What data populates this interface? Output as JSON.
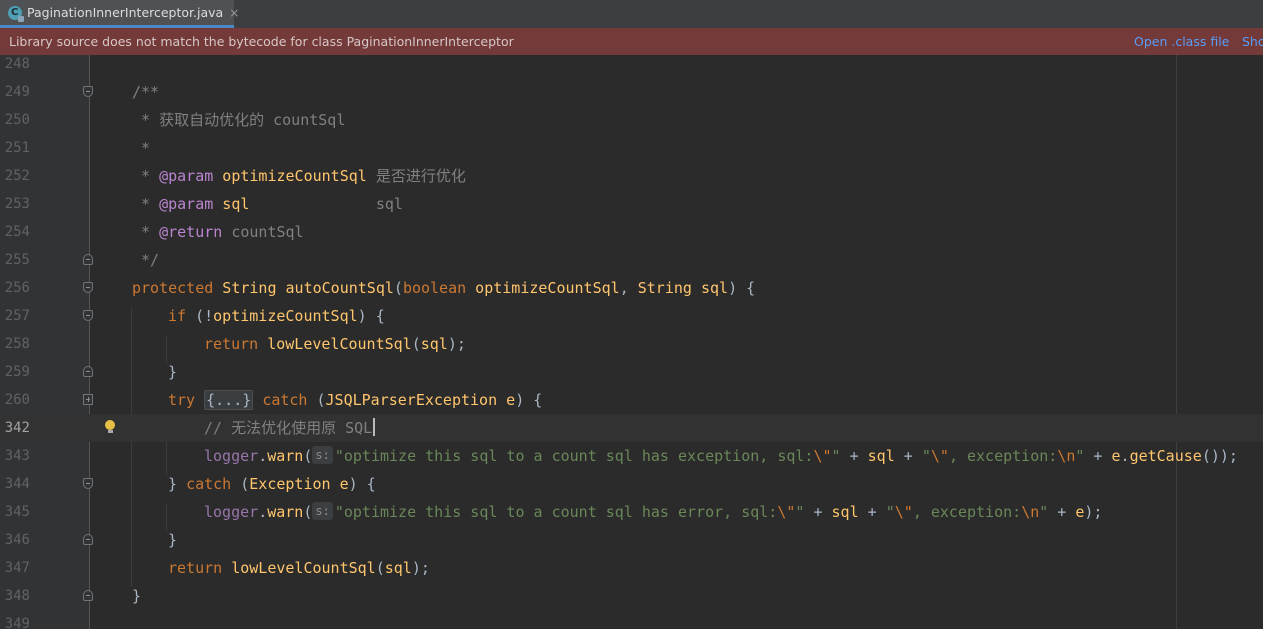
{
  "tab": {
    "title": "PaginationInnerInterceptor.java",
    "icon_letter": "C",
    "close": "×"
  },
  "banner": {
    "message": "Library source does not match the bytecode for class PaginationInnerInterceptor",
    "open_class": "Open .class file",
    "show": "Sho"
  },
  "editor": {
    "current_line": "342",
    "line_numbers": [
      "248",
      "249",
      "250",
      "251",
      "252",
      "253",
      "254",
      "255",
      "256",
      "257",
      "258",
      "259",
      "260",
      "342",
      "343",
      "344",
      "345",
      "346",
      "347",
      "348",
      "349"
    ],
    "code": {
      "l249": "/**",
      "l250_star": " * ",
      "l250_text": "获取自动优化的 countSql",
      "l251": " *",
      "l252_star": " * ",
      "l252_tag": "@param",
      "l252_name": " optimizeCountSql",
      "l252_text": " 是否进行优化",
      "l253_star": " * ",
      "l253_tag": "@param",
      "l253_name": " sql",
      "l253_text": "              sql",
      "l254_star": " * ",
      "l254_tag": "@return",
      "l254_text": " countSql",
      "l255": " */",
      "l256": {
        "kw1": "protected",
        "type1": " String",
        "method": "autoCountSql",
        "kw2": "boolean",
        "p1": " optimizeCountSql",
        "type2": "String",
        "p2": " sql"
      },
      "l257": {
        "kw": "if",
        "rest1": " (!",
        "ref": "optimizeCountSql",
        "rest2": ") {"
      },
      "l258": {
        "kw": "return",
        "call": " lowLevelCountSql",
        "arg": "sql",
        "end": ");"
      },
      "l259": "}",
      "l260": {
        "kw": "try",
        "folded": "{...}",
        "kw2": "catch",
        "exc": "JSQLParserException",
        "var": " e",
        "end": ") {"
      },
      "l342": "// 无法优化使用原 SQL",
      "l343": {
        "obj": "logger",
        "method": "warn",
        "hint": "s:",
        "str1": "\"optimize this sql to a count sql has exception, sql:",
        "esc1": "\\\"",
        "str1_end": "\"",
        "plus1": " + ",
        "var1": "sql",
        "plus2": " + ",
        "str2": "\"",
        "esc2": "\\\"",
        "str2_mid": ", exception:",
        "esc3": "\\n",
        "str2_end": "\"",
        "plus3": " + ",
        "var2": "e",
        "call": "getCause",
        "end": "());"
      },
      "l344": {
        "close": "} ",
        "kw": "catch",
        "exc": "Exception",
        "var": " e",
        "end": ") {"
      },
      "l345": {
        "obj": "logger",
        "method": "warn",
        "hint": "s:",
        "str1": "\"optimize this sql to a count sql has error, sql:",
        "esc1": "\\\"",
        "str1_end": "\"",
        "plus1": " + ",
        "var1": "sql",
        "plus2": " + ",
        "str2": "\"",
        "esc2": "\\\"",
        "str2_mid": ", exception:",
        "esc3": "\\n",
        "str2_end": "\"",
        "plus3": " + ",
        "var2": "e",
        "end": ");"
      },
      "l346": "}",
      "l347": {
        "kw": "return",
        "call": " lowLevelCountSql",
        "arg": "sql",
        "end": ");"
      },
      "l348": "}"
    }
  },
  "colors": {
    "background": "#2b2b2b",
    "gutter": "#313335",
    "banner": "#743a3a",
    "keyword": "#cc7832",
    "string": "#6a8759",
    "method": "#ffc66d",
    "field": "#9876aa",
    "comment": "#808080",
    "link": "#589df6"
  },
  "icons": [
    "java-class-icon",
    "close-icon",
    "fold-icon",
    "intention-bulb-icon"
  ]
}
